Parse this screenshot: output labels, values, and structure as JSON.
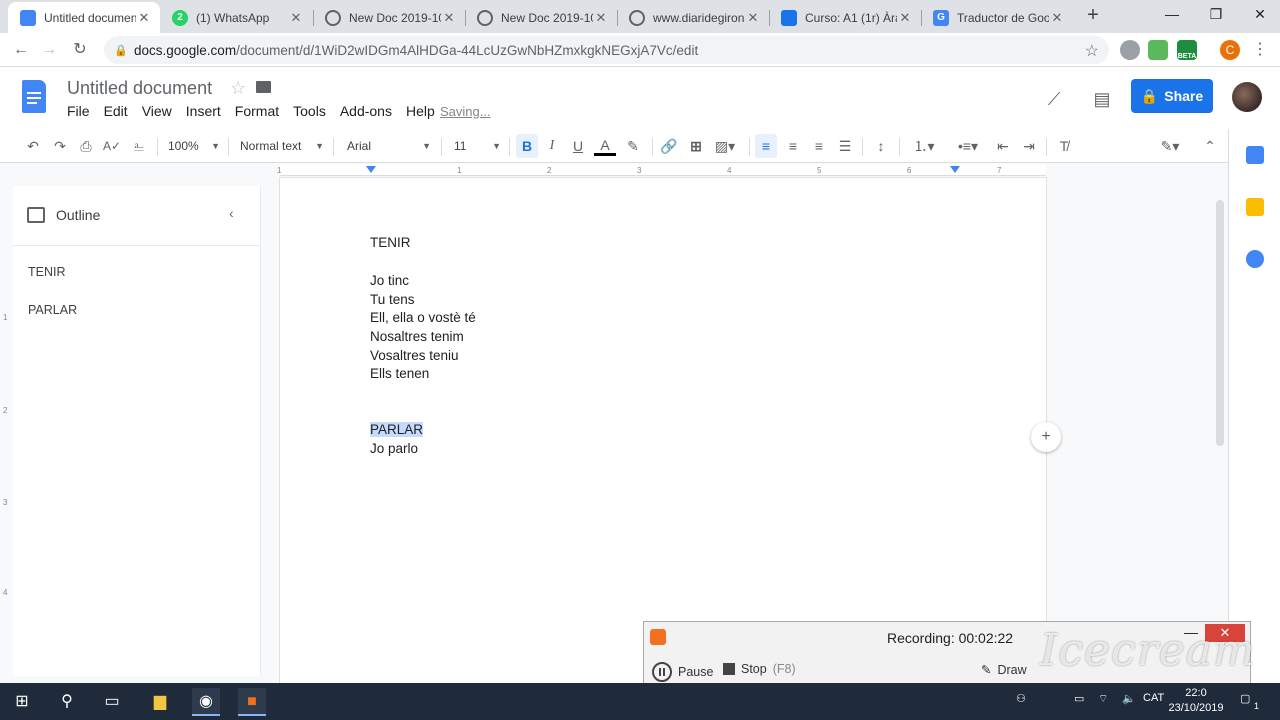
{
  "browser": {
    "tabs": [
      {
        "title": "Untitled documen",
        "icon": "google-docs-icon",
        "color": "#4285f4",
        "active": true
      },
      {
        "title": "(1) WhatsApp",
        "icon": "whatsapp-icon",
        "color": "#25d366",
        "badge": "2"
      },
      {
        "title": "New Doc 2019-10",
        "icon": "globe-icon",
        "color": "#5f6368"
      },
      {
        "title": "New Doc 2019-10",
        "icon": "globe-icon",
        "color": "#5f6368"
      },
      {
        "title": "www.diaridegirona",
        "icon": "globe-icon",
        "color": "#5f6368"
      },
      {
        "title": "Curso: A1 (1r) Àrat",
        "icon": "course-icon",
        "color": "#1a73e8"
      },
      {
        "title": "Traductor de Goog",
        "icon": "google-translate-icon",
        "color": "#4285f4"
      }
    ],
    "url_host": "docs.google.com",
    "url_path": "/document/d/1WiD2wIDGm4AlHDGa-44LcUzGwNbHZmxkgkNEGxjA7Vc/edit",
    "profile_initial": "C",
    "extension_badge": "BETA"
  },
  "docs": {
    "title": "Untitled document",
    "menu": [
      "File",
      "Edit",
      "View",
      "Insert",
      "Format",
      "Tools",
      "Add-ons",
      "Help"
    ],
    "saving_status": "Saving...",
    "share_label": "Share"
  },
  "toolbar": {
    "zoom": "100%",
    "style": "Normal text",
    "font": "Arial",
    "size": "11"
  },
  "ruler": {
    "ticks": [
      "1",
      "1",
      "2",
      "3",
      "4",
      "5",
      "6",
      "7"
    ],
    "vticks": [
      "1",
      "2",
      "3",
      "4"
    ]
  },
  "outline": {
    "title": "Outline",
    "items": [
      "TENIR",
      "PARLAR"
    ]
  },
  "document": {
    "lines": [
      "TENIR",
      "Jo tinc",
      "Tu tens",
      "Ell, ella o vostè té",
      "Nosaltres tenim",
      "Vosaltres teniu",
      "Ells tenen",
      "PARLAR",
      "Jo parlo"
    ]
  },
  "recorder": {
    "status": "Recording: 00:02:22",
    "pause_label": "Pause",
    "stop_label": "Stop",
    "stop_shortcut": "(F8)",
    "draw_label": "Draw",
    "watermark": "Icecream"
  },
  "taskbar": {
    "language": "CAT",
    "time": "22:0",
    "date": "23/10/2019",
    "notification_count": "1"
  },
  "colors": {
    "accent": "#1a73e8",
    "docs_blue": "#4285f4",
    "highlight": "#c6dafc",
    "record_orange": "#f37021"
  }
}
